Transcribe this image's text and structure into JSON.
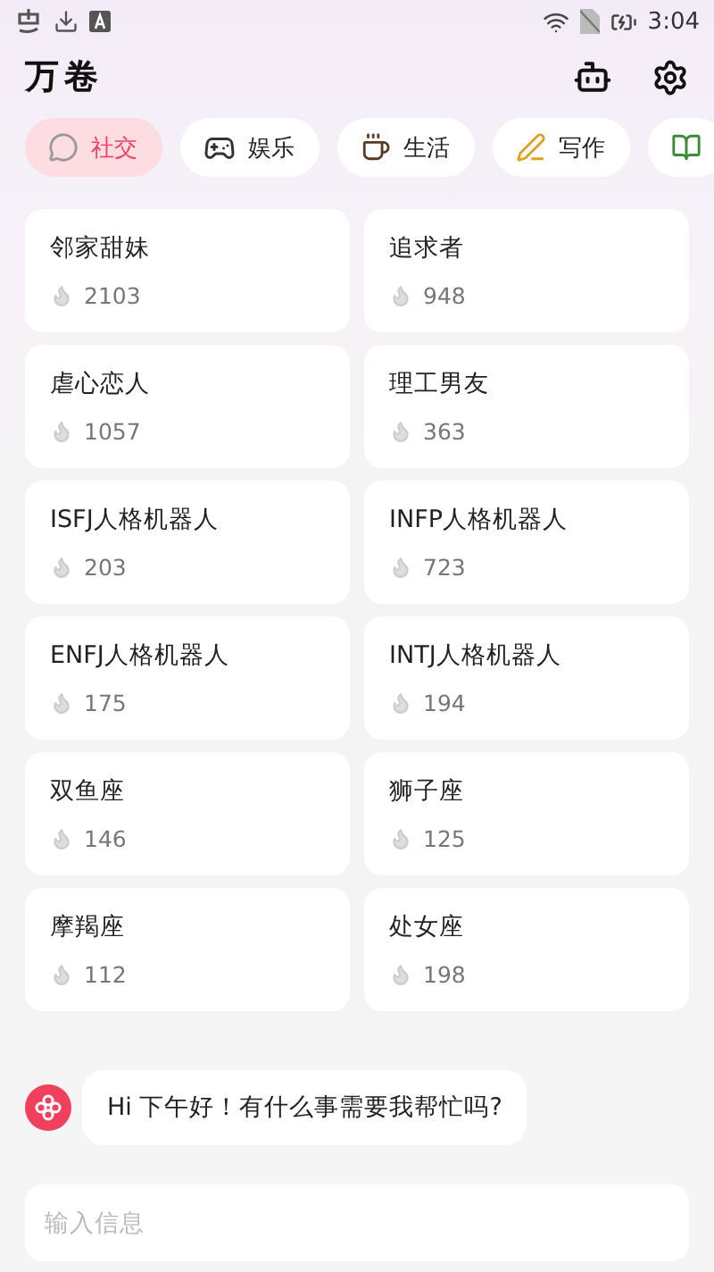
{
  "status_bar": {
    "time": "3:04"
  },
  "header": {
    "title": "万卷"
  },
  "tabs": [
    {
      "label": "社交",
      "selected": true
    },
    {
      "label": "娱乐",
      "selected": false
    },
    {
      "label": "生活",
      "selected": false
    },
    {
      "label": "写作",
      "selected": false
    },
    {
      "selected": false
    }
  ],
  "bots": [
    {
      "name": "邻家甜妹",
      "count": "2103"
    },
    {
      "name": "追求者",
      "count": "948"
    },
    {
      "name": "虐心恋人",
      "count": "1057"
    },
    {
      "name": "理工男友",
      "count": "363"
    },
    {
      "name": "ISFJ人格机器人",
      "count": "203"
    },
    {
      "name": "INFP人格机器人",
      "count": "723"
    },
    {
      "name": "ENFJ人格机器人",
      "count": "175"
    },
    {
      "name": "INTJ人格机器人",
      "count": "194"
    },
    {
      "name": "双鱼座",
      "count": "146"
    },
    {
      "name": "狮子座",
      "count": "125"
    },
    {
      "name": "摩羯座",
      "count": "112"
    },
    {
      "name": "处女座",
      "count": "198"
    }
  ],
  "chat": {
    "message": "Hi 下午好！有什么事需要我帮忙吗?",
    "input": {
      "placeholder": "输入信息"
    }
  }
}
